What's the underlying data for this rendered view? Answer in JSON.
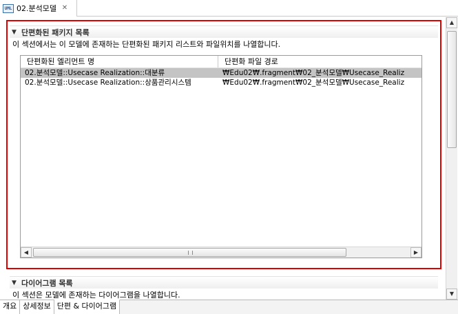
{
  "editor_tab": {
    "icon": "diagram-file-icon",
    "title": "02.분석모델",
    "close": "✕"
  },
  "section_packages": {
    "title": "단편화된 패키지 목록",
    "description": "이 섹션에서는 이 모델에 존재하는 단편화된 패키지 리스트와 파일위치를 나열합니다.",
    "table": {
      "columns": [
        "단편화된 엘리먼트 명",
        "단편화 파일 경로"
      ],
      "rows": [
        [
          "02.분석모델::Usecase Realization::대분류",
          "₩Edu02₩.fragment₩02_분석모델₩Usecase_Realiz"
        ],
        [
          "02.분석모델::Usecase Realization::상품관리시스템",
          "₩Edu02₩.fragment₩02_분석모델₩Usecase_Realiz"
        ]
      ],
      "selected_row": 0
    }
  },
  "section_diagrams": {
    "title": "다이어그램 목록",
    "description": "이 섹션은 모델에 존재하는 다이어그램을 나열합니다."
  },
  "bottom_tabs": [
    {
      "label": "개요"
    },
    {
      "label": "상세정보"
    },
    {
      "label": "단편 & 다이어그램",
      "active": true
    }
  ],
  "colors": {
    "highlight": "#e00000",
    "selected_row": "#c4c4c4"
  }
}
